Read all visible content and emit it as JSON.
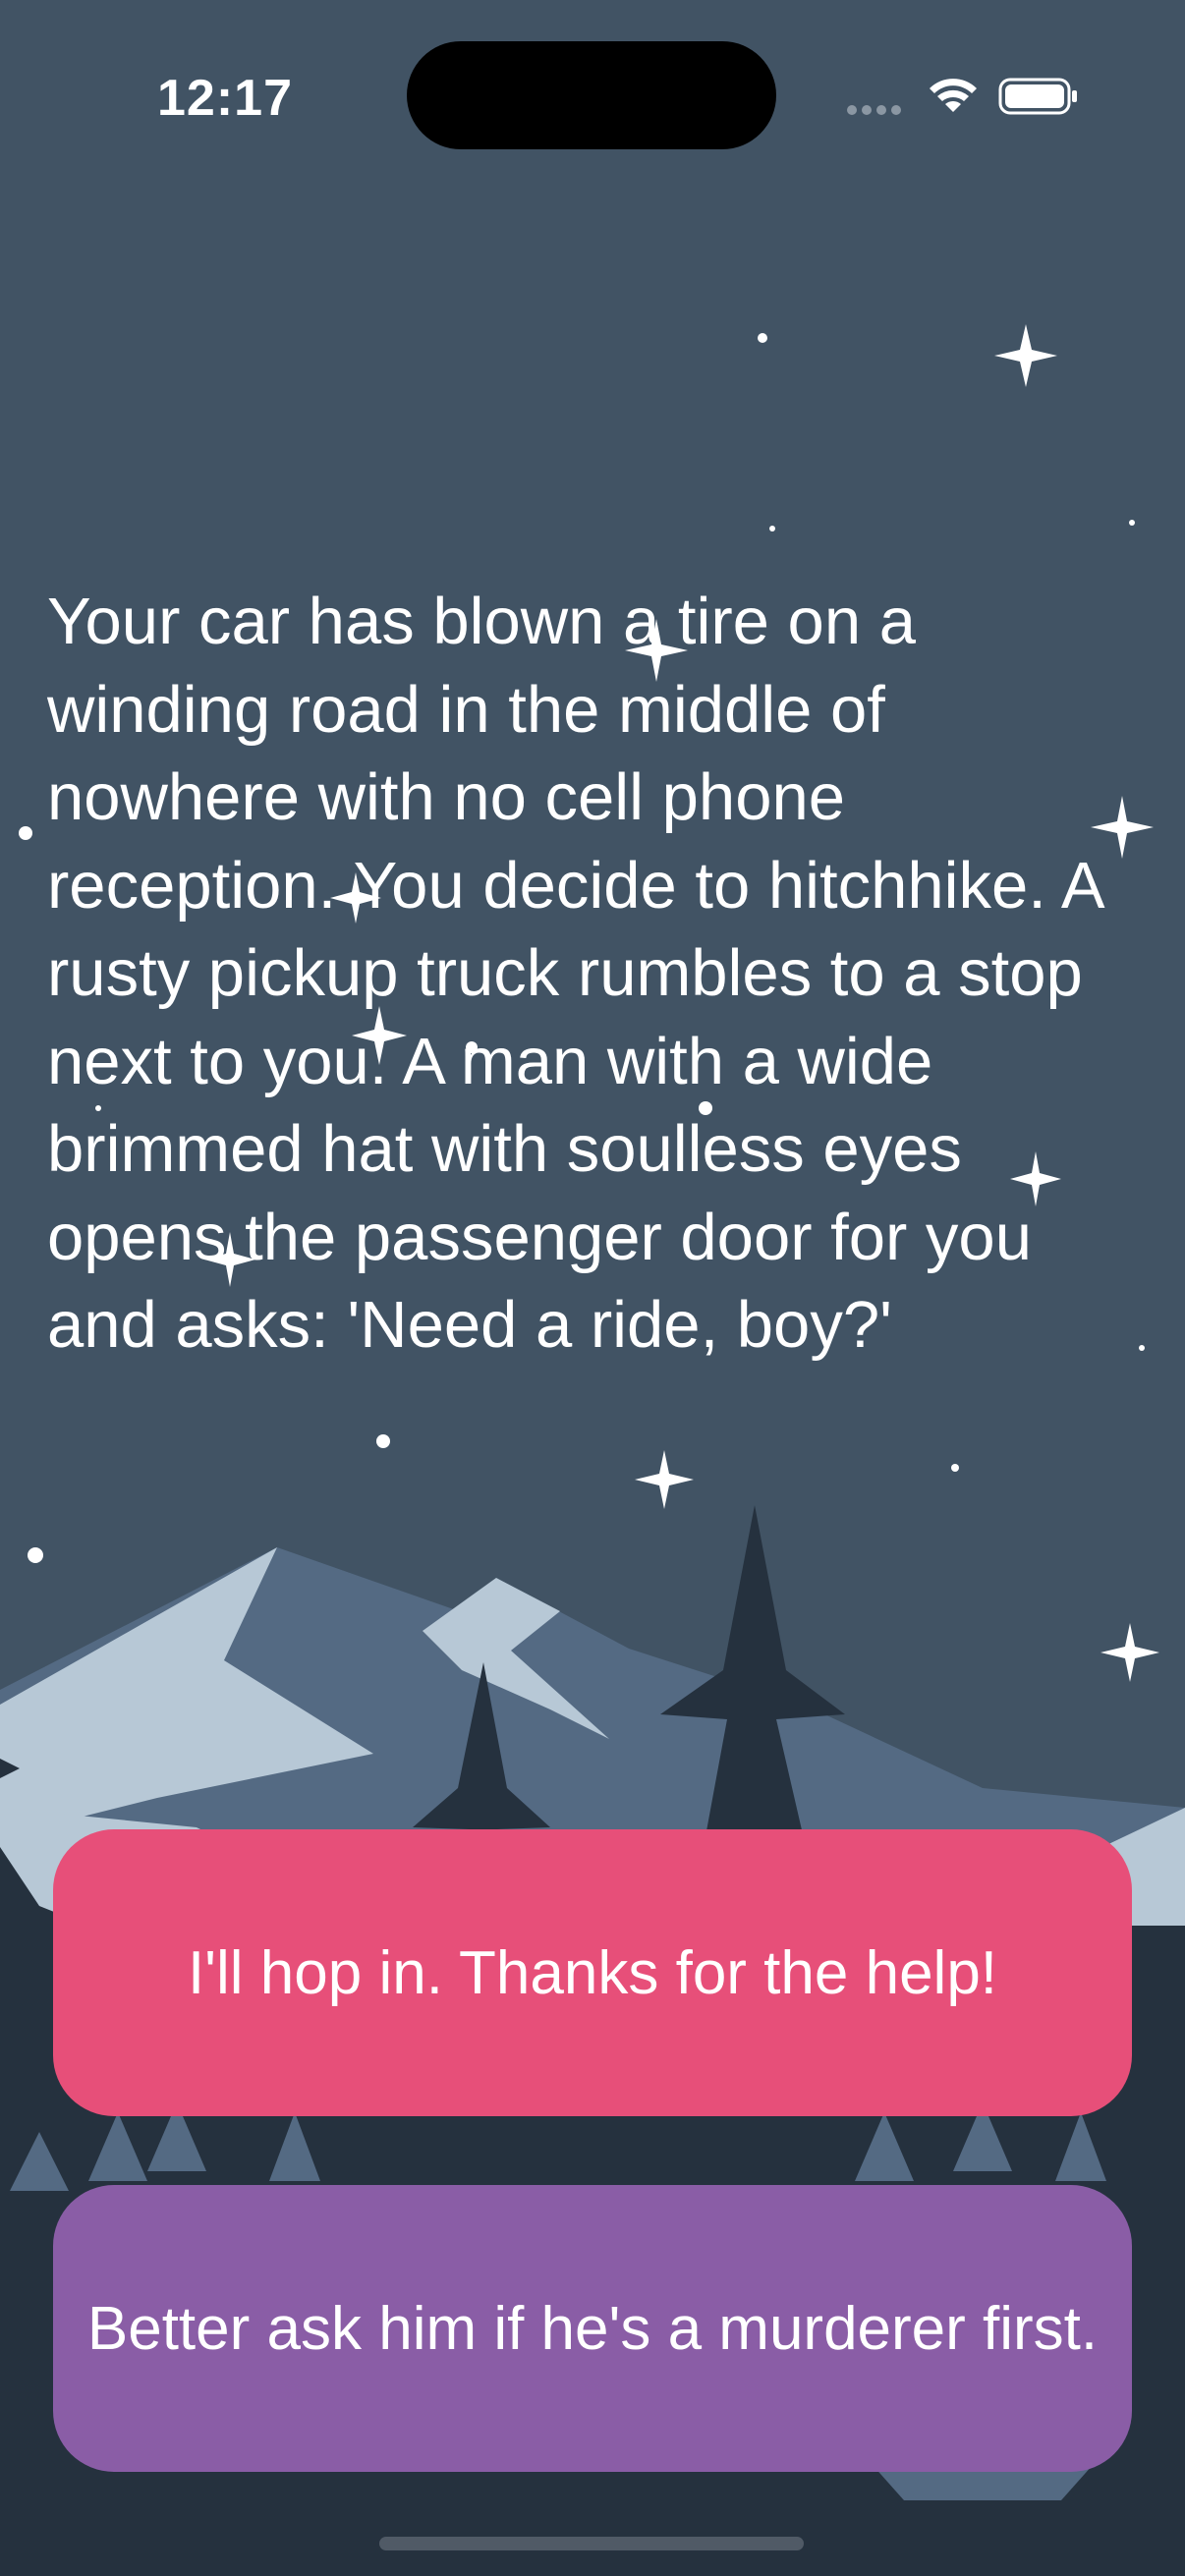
{
  "status_bar": {
    "time": "12:17",
    "icons": [
      "cellular-signal-icon",
      "wifi-icon",
      "battery-icon"
    ]
  },
  "story": {
    "text": "Your car has blown a tire on a winding road in the middle of nowhere with no cell phone reception. You decide to hitchhike. A rusty pickup truck rumbles to a stop next to you. A man with a wide brimmed hat with soulless eyes opens the passenger door for you and asks: 'Need a ride, boy?'"
  },
  "choices": [
    {
      "label": "I'll hop in. Thanks for the help!",
      "color": "#e74f79"
    },
    {
      "label": "Better ask him if he's a murderer first.",
      "color": "#8a5da6"
    }
  ],
  "colors": {
    "sky": "#415364",
    "mountain_light": "#b7c8d6",
    "mountain_mid": "#546a83",
    "tree_dark": "#25313e"
  }
}
